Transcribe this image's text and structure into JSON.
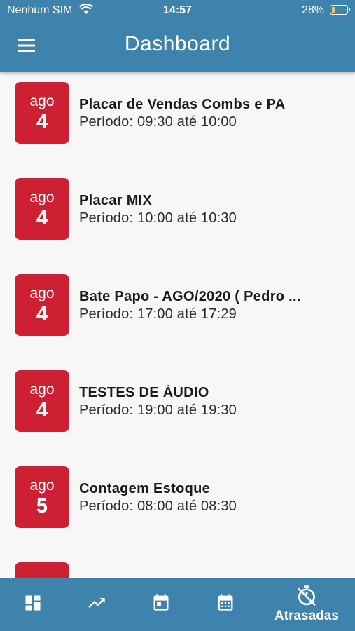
{
  "status": {
    "carrier": "Nenhum SIM",
    "time": "14:57",
    "battery": "28%",
    "battery_level": 0.28
  },
  "header": {
    "title": "Dashboard",
    "menu_icon": "hamburger-menu-icon"
  },
  "events": [
    {
      "month": "ago",
      "day": "4",
      "title": "Placar de Vendas Combs e PA",
      "period": "Período: 09:30 até 10:00"
    },
    {
      "month": "ago",
      "day": "4",
      "title": "Placar MIX",
      "period": "Período: 10:00 até 10:30"
    },
    {
      "month": "ago",
      "day": "4",
      "title": "Bate Papo - AGO/2020 ( Pedro ...",
      "period": "Período: 17:00 até 17:29"
    },
    {
      "month": "ago",
      "day": "4",
      "title": "TESTES DE ÁUDIO",
      "period": "Período: 19:00 até 19:30"
    },
    {
      "month": "ago",
      "day": "5",
      "title": "Contagem Estoque",
      "period": "Período: 08:00 até 08:30"
    }
  ],
  "bottom_nav": {
    "items": [
      {
        "icon": "dashboard-icon"
      },
      {
        "icon": "trending-up-icon"
      },
      {
        "icon": "calendar-today-icon"
      },
      {
        "icon": "calendar-month-icon"
      },
      {
        "icon": "timer-off-icon",
        "label": "Atrasadas",
        "active": true
      }
    ]
  },
  "colors": {
    "primary": "#3e83ab",
    "badge": "#cd2133",
    "background": "#f7f7f7",
    "divider": "#dcdcdc"
  }
}
